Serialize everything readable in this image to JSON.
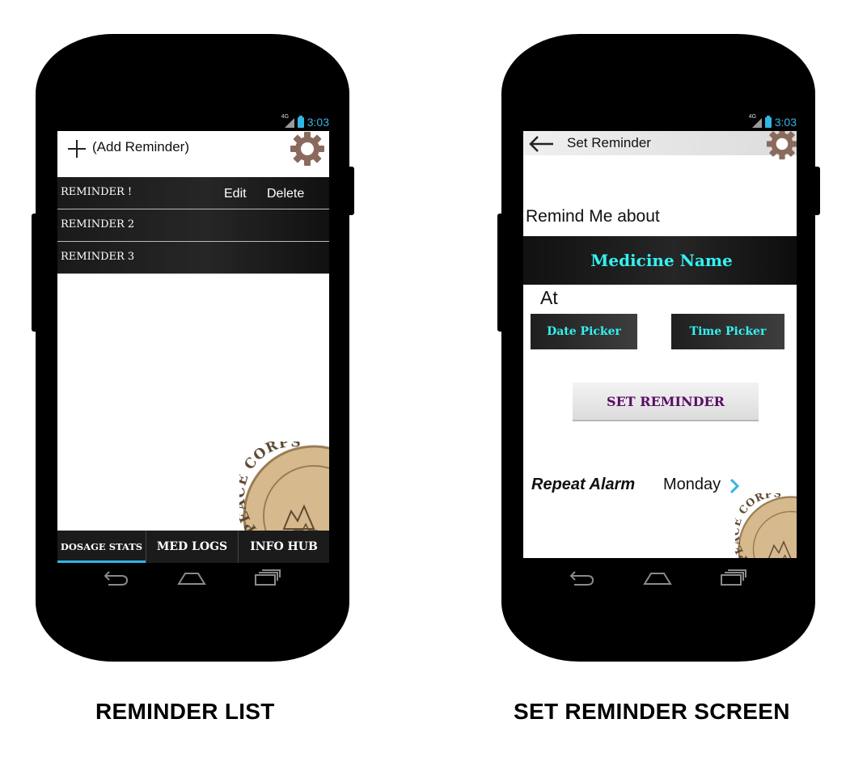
{
  "colors": {
    "accent_blue": "#33b5e5",
    "cyan_text": "#33f2f2",
    "purple_text": "#5a0d66",
    "gear": "#8b6a5e"
  },
  "status_bar": {
    "network": "4G",
    "time": "3:03"
  },
  "reminder_list": {
    "add_label": "(Add Reminder)",
    "icons": {
      "add": "plus-icon",
      "settings": "gear-icon"
    },
    "items": [
      {
        "label": "REMINDER !",
        "edit": "Edit",
        "delete": "Delete"
      },
      {
        "label": "REMINDER 2"
      },
      {
        "label": "REMINDER 3"
      }
    ],
    "tabs": [
      {
        "label": "DOSAGE STATS",
        "active": true
      },
      {
        "label": "MED LOGS",
        "active": false
      },
      {
        "label": "INFO HUB",
        "active": false
      }
    ],
    "logo_text": "PEACE CORPS",
    "caption": "REMINDER LIST"
  },
  "set_reminder": {
    "title": "Set Reminder",
    "remind_label": "Remind Me about",
    "medicine_name": "Medicine Name",
    "at_label": "At",
    "date_picker": "Date Picker",
    "time_picker": "Time Picker",
    "set_button": "SET REMINDER",
    "repeat_label": "Repeat Alarm",
    "repeat_value": "Monday",
    "logo_text": "PEACE CORPS",
    "caption": "SET REMINDER SCREEN"
  },
  "nav_icons": [
    "back-nav-icon",
    "home-nav-icon",
    "recents-nav-icon"
  ]
}
